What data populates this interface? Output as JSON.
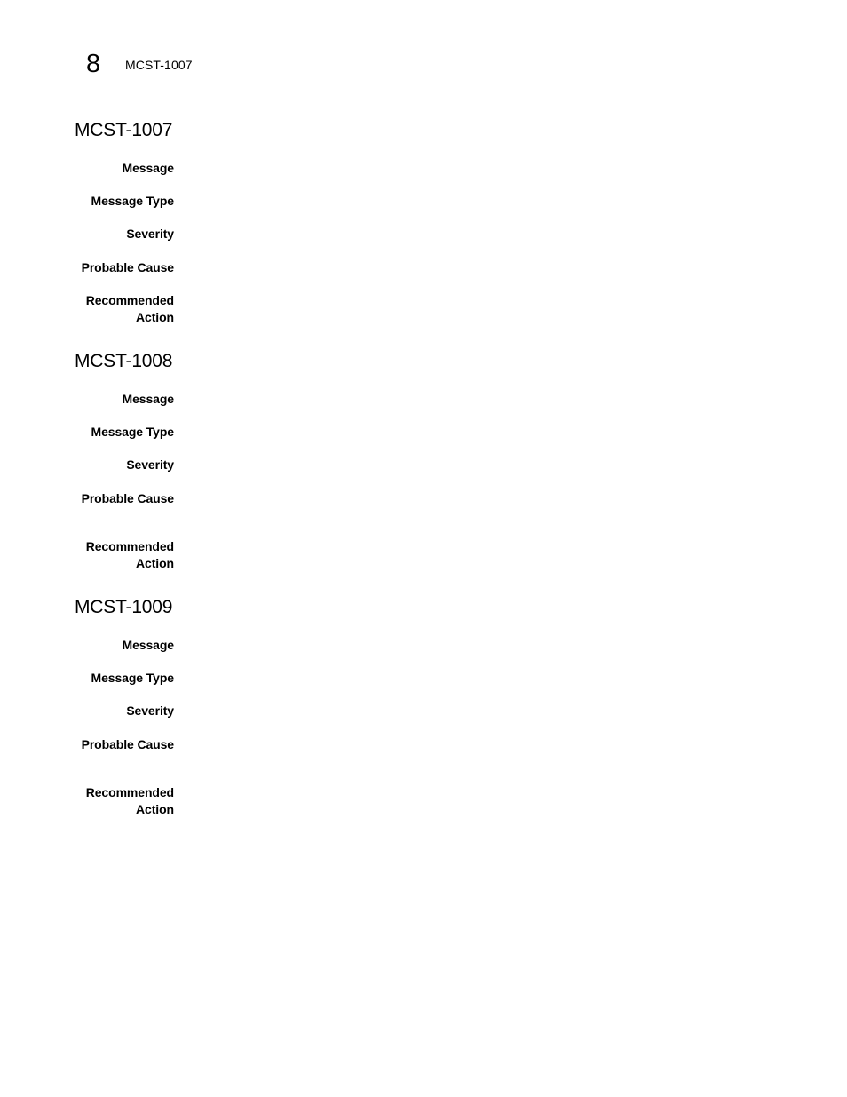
{
  "header": {
    "chapter_number": "8",
    "running_title": "MCST-1007"
  },
  "sections": [
    {
      "title": "MCST-1007",
      "fields": [
        {
          "label": "Message",
          "value": ""
        },
        {
          "label": "Message Type",
          "value": ""
        },
        {
          "label": "Severity",
          "value": ""
        },
        {
          "label": "Probable Cause",
          "value": ""
        },
        {
          "label": "Recommended Action",
          "label_lines": [
            "Recommended",
            "Action"
          ],
          "value": ""
        }
      ]
    },
    {
      "title": "MCST-1008",
      "fields": [
        {
          "label": "Message",
          "value": ""
        },
        {
          "label": "Message Type",
          "value": ""
        },
        {
          "label": "Severity",
          "value": ""
        },
        {
          "label": "Probable Cause",
          "value": ""
        },
        {
          "label": "Recommended Action",
          "label_lines": [
            "Recommended",
            "Action"
          ],
          "value": ""
        }
      ]
    },
    {
      "title": "MCST-1009",
      "fields": [
        {
          "label": "Message",
          "value": ""
        },
        {
          "label": "Message Type",
          "value": ""
        },
        {
          "label": "Severity",
          "value": ""
        },
        {
          "label": "Probable Cause",
          "value": ""
        },
        {
          "label": "Recommended Action",
          "label_lines": [
            "Recommended",
            "Action"
          ],
          "value": ""
        }
      ]
    }
  ]
}
